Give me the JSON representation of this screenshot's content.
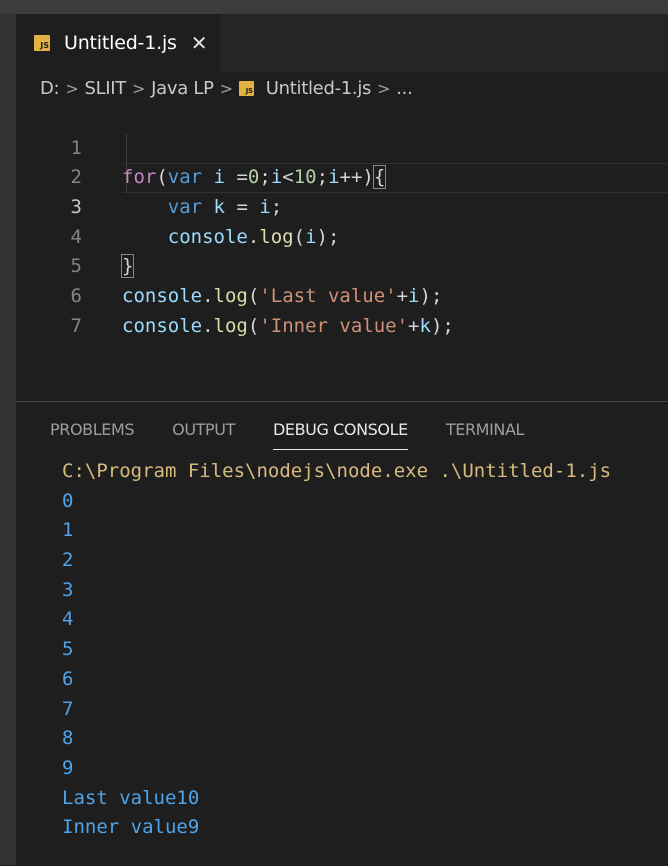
{
  "tab": {
    "badge": "JS",
    "title": "Untitled-1.js",
    "close": "✕"
  },
  "breadcrumb": {
    "drive": "D:",
    "folder1": "SLIIT",
    "folder2": "Java LP",
    "file": "Untitled-1.js",
    "more": "..."
  },
  "code": {
    "line_numbers": [
      "1",
      "2",
      "3",
      "4",
      "5",
      "6",
      "7"
    ],
    "l1": {
      "for": "for",
      "open": "(",
      "var": "var",
      "sp": " ",
      "i": "i",
      "eq": " =",
      "zero": "0",
      "semi1": ";",
      "i2": "i",
      "lt": "<",
      "ten": "10",
      "semi2": ";",
      "i3": "i",
      "inc": "++)",
      "brace": "{"
    },
    "l2": {
      "var": "var",
      "k": "k",
      "eq": " = ",
      "i": "i",
      "semi": ";"
    },
    "l3": {
      "console": "console",
      "dot": ".",
      "log": "log",
      "open": "(",
      "i": "i",
      "close": ");"
    },
    "l4": {
      "brace": "}"
    },
    "l5": {
      "console": "console",
      "dot": ".",
      "log": "log",
      "open": "(",
      "str": "'Last value'",
      "plus": "+",
      "i": "i",
      "close": ");"
    },
    "l6": {
      "console": "console",
      "dot": ".",
      "log": "log",
      "open": "(",
      "str": "'Inner value'",
      "plus": "+",
      "k": "k",
      "close": ");"
    }
  },
  "panel": {
    "tabs": [
      "PROBLEMS",
      "OUTPUT",
      "DEBUG CONSOLE",
      "TERMINAL"
    ],
    "active_tab": "DEBUG CONSOLE"
  },
  "console_output": [
    "C:\\Program Files\\nodejs\\node.exe .\\Untitled-1.js",
    "0",
    "1",
    "2",
    "3",
    "4",
    "5",
    "6",
    "7",
    "8",
    "9",
    "Last value10",
    "Inner value9"
  ],
  "colors": {
    "background": "#1e1e1e",
    "keyword": "#569cd6",
    "variable": "#9cdcfe",
    "function": "#dcdcaa",
    "string": "#ce9178",
    "number": "#b5cea8",
    "console_value": "#4fa3e8",
    "console_command": "#d7ba7d"
  }
}
